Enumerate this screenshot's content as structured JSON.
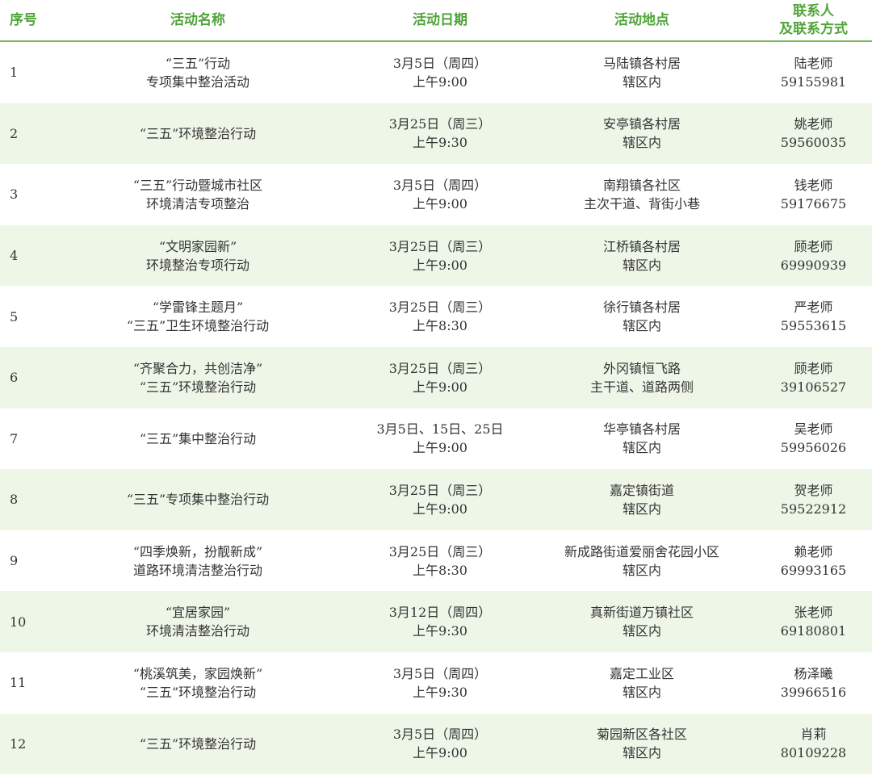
{
  "header": {
    "seq": "序号",
    "name": "活动名称",
    "date": "活动日期",
    "location": "活动地点",
    "contact_line1": "联系人",
    "contact_line2": "及联系方式"
  },
  "rows": [
    {
      "seq": "1",
      "name1": "“三五”行动",
      "name2": "专项集中整治活动",
      "date1": "3月5日（周四）",
      "date2": "上午9:00",
      "loc1": "马陆镇各村居",
      "loc2": "辖区内",
      "person": "陆老师",
      "phone": "59155981"
    },
    {
      "seq": "2",
      "name1": "“三五”环境整治行动",
      "name2": "",
      "date1": "3月25日（周三）",
      "date2": "上午9:30",
      "loc1": "安亭镇各村居",
      "loc2": "辖区内",
      "person": "姚老师",
      "phone": "59560035"
    },
    {
      "seq": "3",
      "name1": "“三五”行动暨城市社区",
      "name2": "环境清洁专项整治",
      "date1": "3月5日（周四）",
      "date2": "上午9:00",
      "loc1": "南翔镇各社区",
      "loc2": "主次干道、背街小巷",
      "person": "钱老师",
      "phone": "59176675"
    },
    {
      "seq": "4",
      "name1": "“文明家园新”",
      "name2": "环境整治专项行动",
      "date1": "3月25日（周三）",
      "date2": "上午9:00",
      "loc1": "江桥镇各村居",
      "loc2": "辖区内",
      "person": "顾老师",
      "phone": "69990939"
    },
    {
      "seq": "5",
      "name1": "“学雷锋主题月”",
      "name2": "“三五”卫生环境整治行动",
      "date1": "3月25日（周三）",
      "date2": "上午8:30",
      "loc1": "徐行镇各村居",
      "loc2": "辖区内",
      "person": "严老师",
      "phone": "59553615"
    },
    {
      "seq": "6",
      "name1": "“齐聚合力，共创洁净”",
      "name2": "“三五”环境整治行动",
      "date1": "3月25日（周三）",
      "date2": "上午9:00",
      "loc1": "外冈镇恒飞路",
      "loc2": "主干道、道路两侧",
      "person": "顾老师",
      "phone": "39106527"
    },
    {
      "seq": "7",
      "name1": "“三五”集中整治行动",
      "name2": "",
      "date1": "3月5日、15日、25日",
      "date2": "上午9:00",
      "loc1": "华亭镇各村居",
      "loc2": "辖区内",
      "person": "吴老师",
      "phone": "59956026"
    },
    {
      "seq": "8",
      "name1": "“三五”专项集中整治行动",
      "name2": "",
      "date1": "3月25日（周三）",
      "date2": "上午9:00",
      "loc1": "嘉定镇街道",
      "loc2": "辖区内",
      "person": "贺老师",
      "phone": "59522912"
    },
    {
      "seq": "9",
      "name1": "“四季焕新，扮靓新成”",
      "name2": "道路环境清洁整治行动",
      "date1": "3月25日（周三）",
      "date2": "上午8:30",
      "loc1": "新成路街道爱丽舍花园小区",
      "loc2": "辖区内",
      "person": "赖老师",
      "phone": "69993165"
    },
    {
      "seq": "10",
      "name1": "“宜居家园”",
      "name2": "环境清洁整治行动",
      "date1": "3月12日（周四）",
      "date2": "上午9:30",
      "loc1": "真新街道万镇社区",
      "loc2": "辖区内",
      "person": "张老师",
      "phone": "69180801"
    },
    {
      "seq": "11",
      "name1": "“桃溪筑美，家园焕新”",
      "name2": "“三五”环境整治行动",
      "date1": "3月5日（周四）",
      "date2": "上午9:30",
      "loc1": "嘉定工业区",
      "loc2": "辖区内",
      "person": "杨泽曦",
      "phone": "39966516"
    },
    {
      "seq": "12",
      "name1": "“三五”环境整治行动",
      "name2": "",
      "date1": "3月5日（周四）",
      "date2": "上午9:00",
      "loc1": "菊园新区各社区",
      "loc2": "辖区内",
      "person": "肖莉",
      "phone": "80109228"
    }
  ]
}
